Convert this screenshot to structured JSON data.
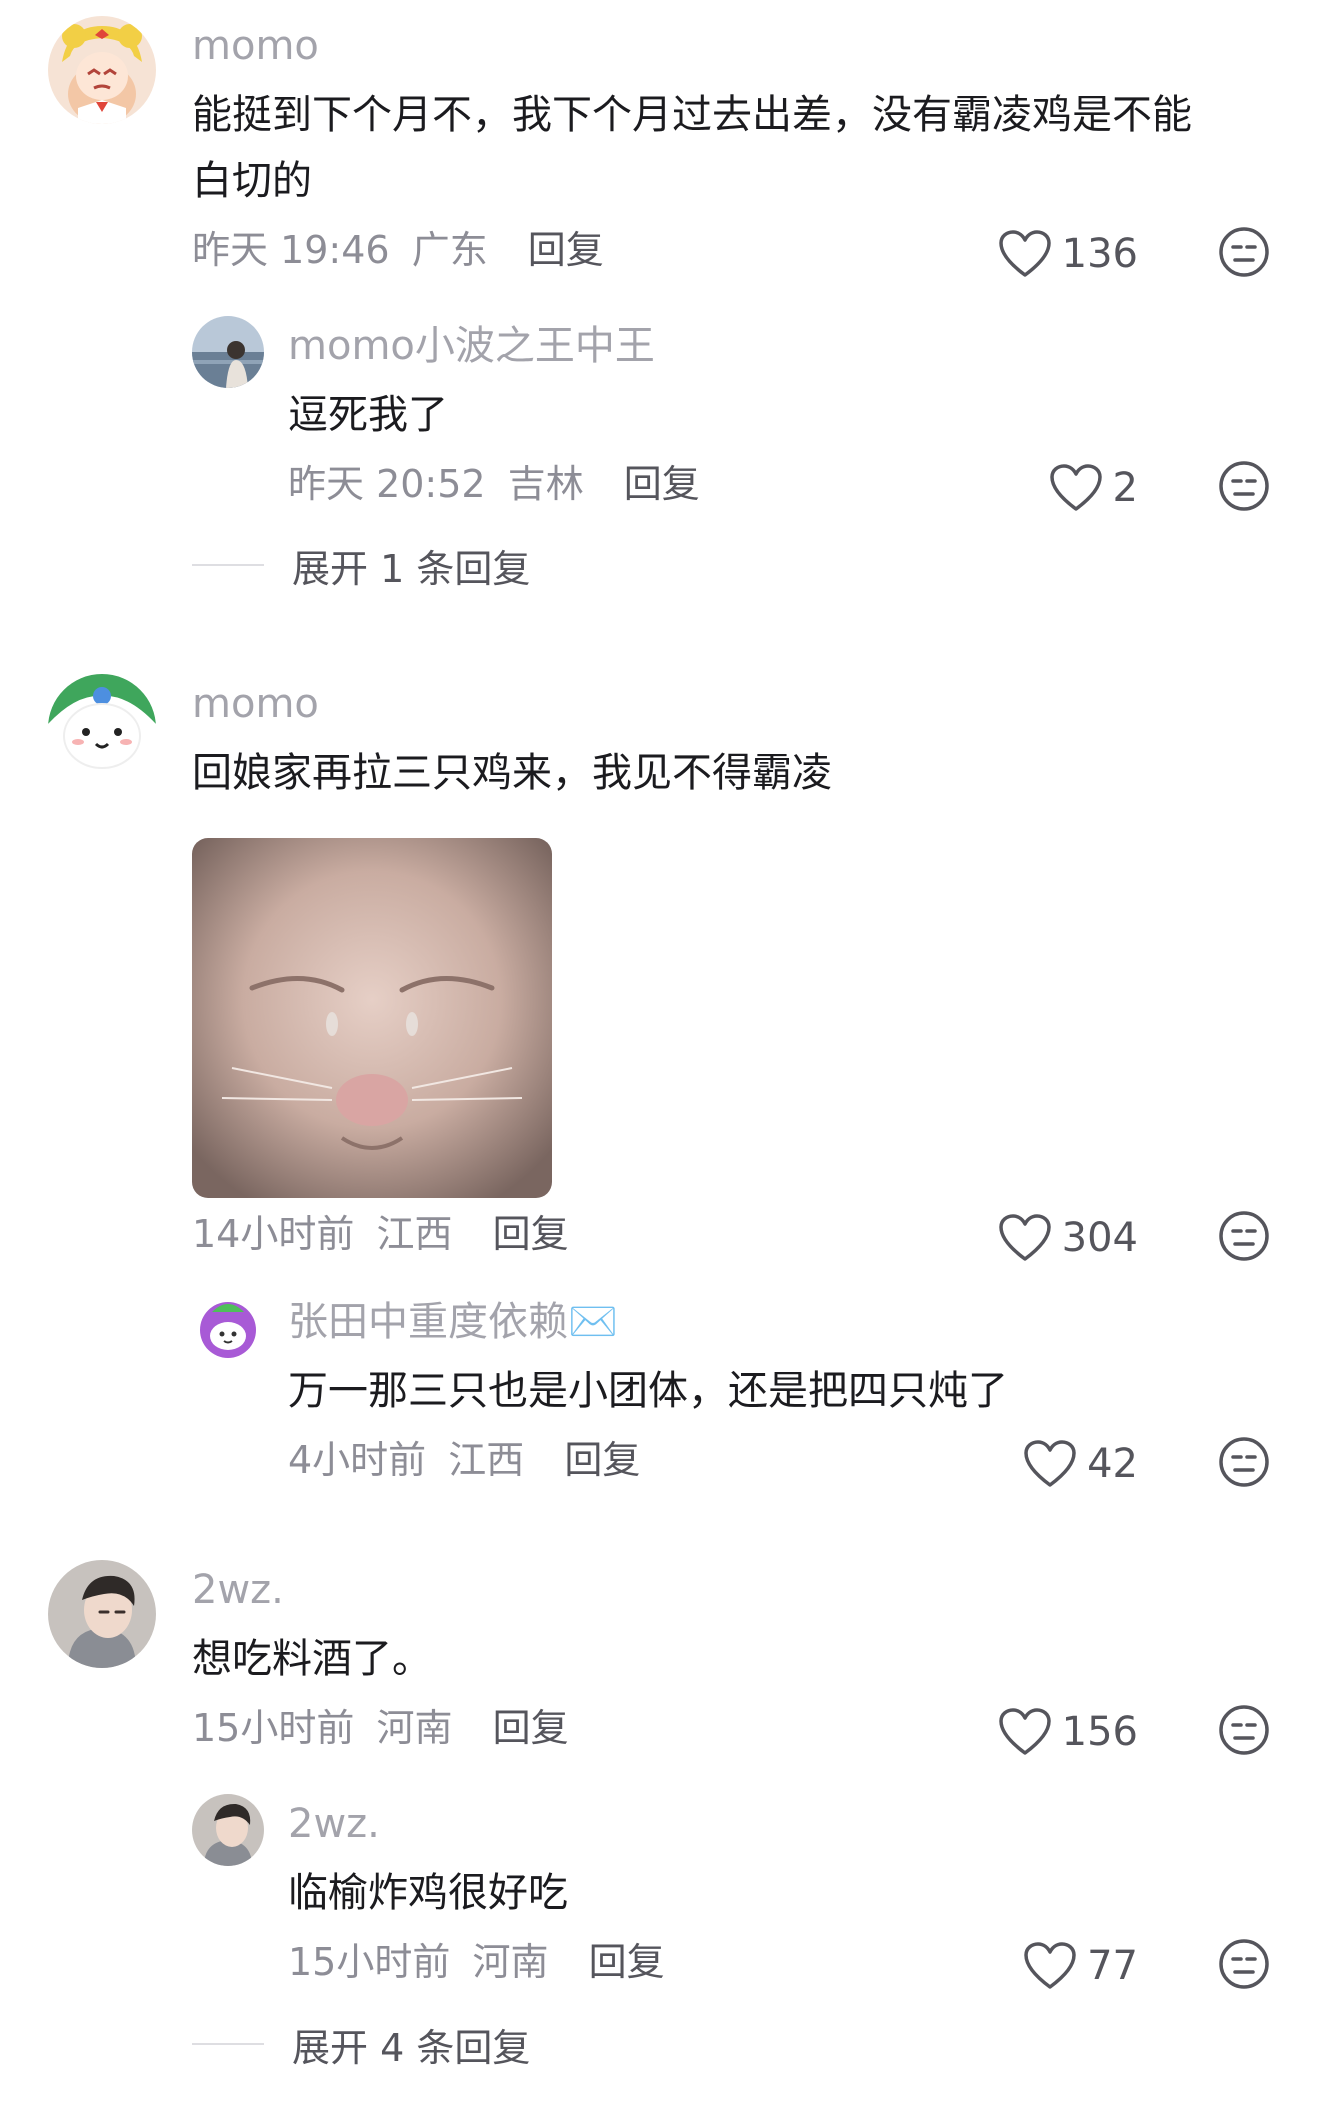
{
  "comments": [
    {
      "username": "momo",
      "avatar": "sailor-moon-avatar-icon",
      "text_lines": [
        "能挺到下个月不，我下个月过去出差，没有霸凌鸡是不能",
        "白切的"
      ],
      "time": "昨天 19:46",
      "location": "广东",
      "reply_label": "回复",
      "likes": "136",
      "replies": [
        {
          "username": "momo小波之王中王",
          "avatar": "seaside-photo-avatar-icon",
          "text": "逗死我了",
          "time": "昨天 20:52",
          "location": "吉林",
          "reply_label": "回复",
          "likes": "2"
        }
      ],
      "expand_label": "展开 1 条回复"
    },
    {
      "username": "momo",
      "avatar": "bear-avatar-icon",
      "text": "回娘家再拉三只鸡来，我见不得霸凌",
      "image": "crying-cat-image",
      "time": "14小时前",
      "location": "江西",
      "reply_label": "回复",
      "likes": "304",
      "replies": [
        {
          "username": "张田中重度依赖✉️",
          "avatar": "purple-cartoon-avatar-icon",
          "text": "万一那三只也是小团体，还是把四只炖了",
          "time": "4小时前",
          "location": "江西",
          "reply_label": "回复",
          "likes": "42"
        }
      ]
    },
    {
      "username": "2wz.",
      "avatar": "person-photo-avatar-icon",
      "text": "想吃料酒了。",
      "time": "15小时前",
      "location": "河南",
      "reply_label": "回复",
      "likes": "156",
      "replies": [
        {
          "username": "2wz.",
          "avatar": "person-photo-avatar-icon",
          "text": "临榆炸鸡很好吃",
          "time": "15小时前",
          "location": "河南",
          "reply_label": "回复",
          "likes": "77"
        }
      ],
      "expand_label": "展开 4 条回复"
    }
  ],
  "colors": {
    "text": "#1b1b1f",
    "username": "#a3a3ab",
    "meta": "#8d8d96",
    "icon": "#55555c",
    "divider": "#dedee2"
  }
}
